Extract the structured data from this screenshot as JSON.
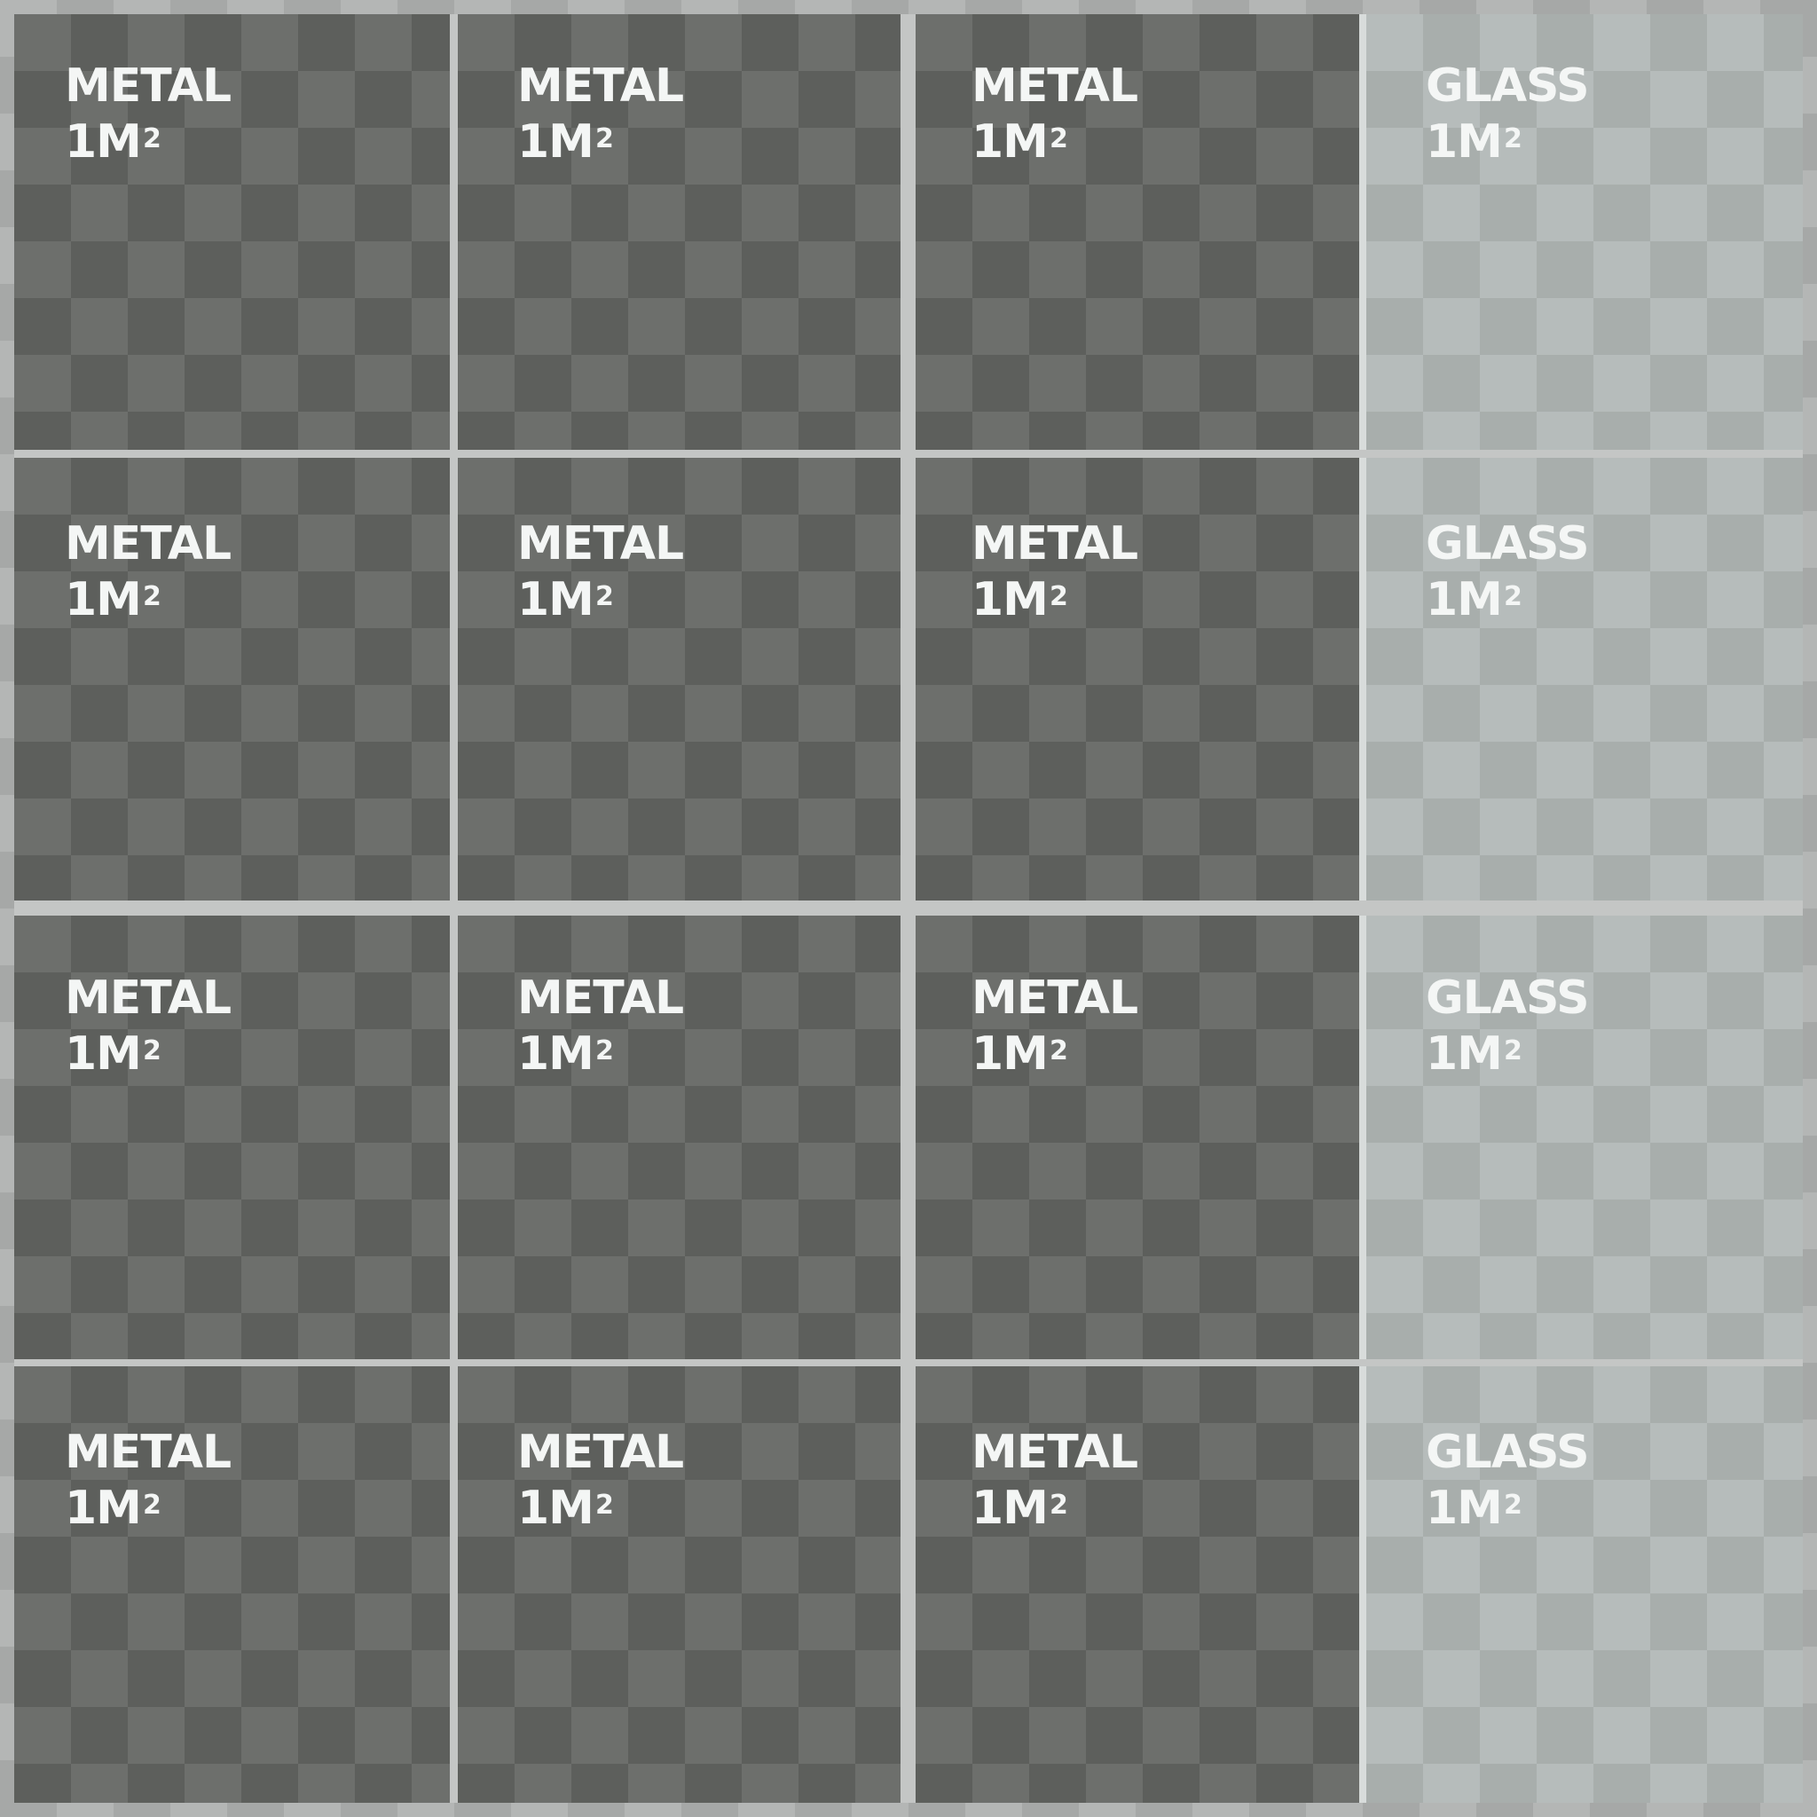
{
  "tiles": [
    {
      "material": "METAL",
      "area": "1M",
      "exp": "2"
    },
    {
      "material": "METAL",
      "area": "1M",
      "exp": "2"
    },
    {
      "material": "METAL",
      "area": "1M",
      "exp": "2"
    },
    {
      "material": "GLASS",
      "area": "1M",
      "exp": "2"
    },
    {
      "material": "METAL",
      "area": "1M",
      "exp": "2"
    },
    {
      "material": "METAL",
      "area": "1M",
      "exp": "2"
    },
    {
      "material": "METAL",
      "area": "1M",
      "exp": "2"
    },
    {
      "material": "GLASS",
      "area": "1M",
      "exp": "2"
    },
    {
      "material": "METAL",
      "area": "1M",
      "exp": "2"
    },
    {
      "material": "METAL",
      "area": "1M",
      "exp": "2"
    },
    {
      "material": "METAL",
      "area": "1M",
      "exp": "2"
    },
    {
      "material": "GLASS",
      "area": "1M",
      "exp": "2"
    },
    {
      "material": "METAL",
      "area": "1M",
      "exp": "2"
    },
    {
      "material": "METAL",
      "area": "1M",
      "exp": "2"
    },
    {
      "material": "METAL",
      "area": "1M",
      "exp": "2"
    },
    {
      "material": "GLASS",
      "area": "1M",
      "exp": "2"
    }
  ],
  "colors": {
    "metal_light": "#6d6f6c",
    "metal_dark": "#5d5f5c",
    "glass_light": "#b6bcbb",
    "glass_dark": "#a8aeac",
    "label_text": "#f4f6f5"
  }
}
